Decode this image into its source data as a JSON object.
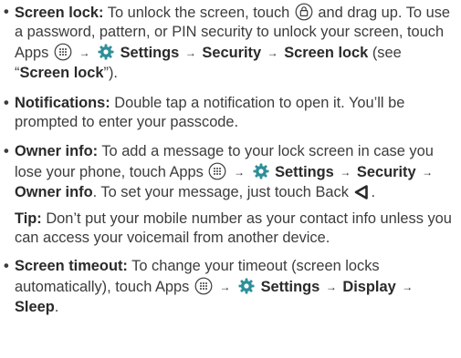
{
  "items": [
    {
      "label": "Screen lock:",
      "t1": "To unlock the screen, touch",
      "t2": "and drag up. To use a password, pattern, or PIN security to unlock your screen, touch Apps",
      "settings": "Settings",
      "security": "Security",
      "screen_lock_path": "Screen lock",
      "t3": "(see “",
      "ref": "Screen lock",
      "t4": "”)."
    },
    {
      "label": "Notifications:",
      "text": "Double tap a notification to open it. You’ll be prompted to enter your passcode."
    },
    {
      "label": "Owner info:",
      "t1": "To add a message to your lock screen in case you lose your phone, touch Apps",
      "settings": "Settings",
      "security": "Security",
      "owner_info": "Owner info",
      "t2": ". To set your message, just touch Back"
    },
    {
      "label": "Screen timeout:",
      "t1": "To change your timeout (screen locks automatically), touch Apps",
      "settings": "Settings",
      "display": "Display",
      "sleep": "Sleep",
      "t2": "."
    }
  ],
  "tip": {
    "label": "Tip:",
    "text": "Don’t put your mobile number as your contact info unless you can access your voicemail from another device."
  },
  "bullet": "•",
  "arrow": "→",
  "icons": [
    "lock-icon",
    "apps-icon",
    "settings-gear-icon",
    "back-icon"
  ],
  "colors": {
    "text": "#3c3c3c",
    "bold": "#2a2a2a",
    "settings_icon": "#2e8f99"
  }
}
